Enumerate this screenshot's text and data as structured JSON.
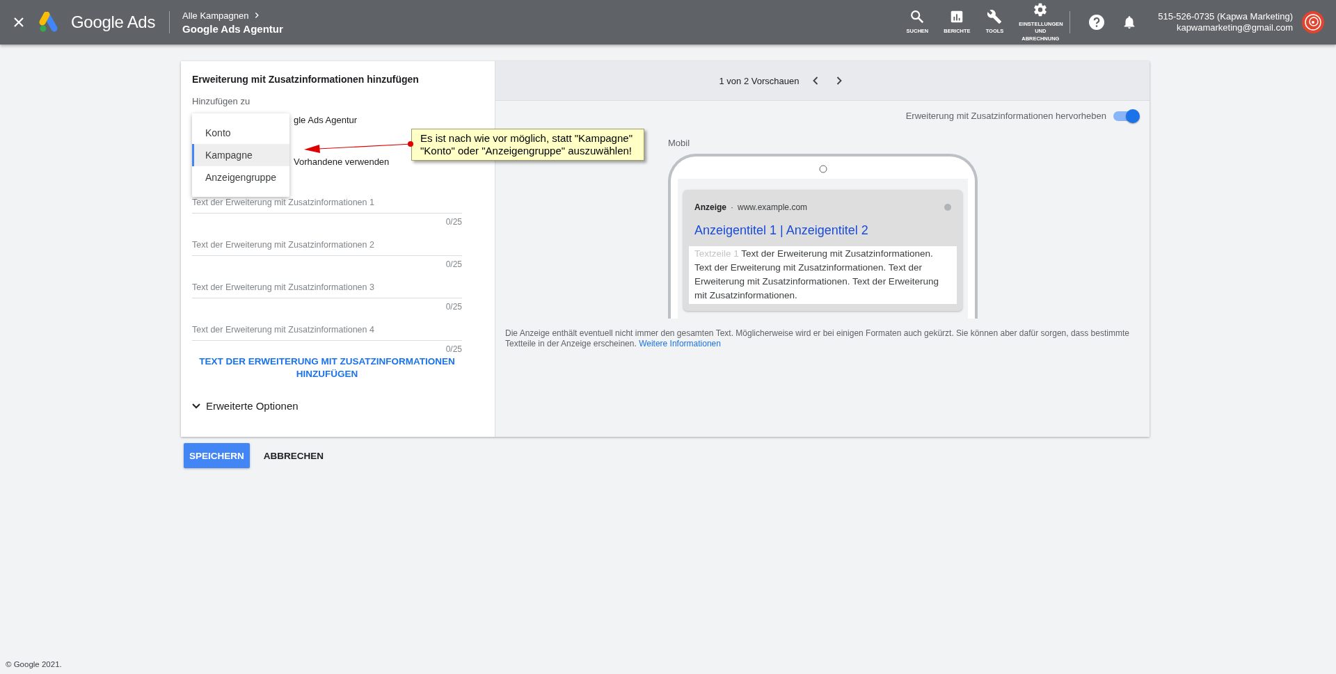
{
  "header": {
    "brand": "Google Ads",
    "breadcrumb": "Alle Kampagnen",
    "account": "Google Ads Agentur",
    "tools": [
      {
        "kind": "search",
        "label": "SUCHEN"
      },
      {
        "kind": "reports",
        "label": "BERICHTE"
      },
      {
        "kind": "tools",
        "label": "TOOLS"
      },
      {
        "kind": "settings",
        "label": "EINSTELLUNGEN UND ABRECHNUNG"
      }
    ],
    "phone": "515-526-0735 (Kapwa Marketing)",
    "email": "kapwamarketing@gmail.com"
  },
  "form": {
    "title": "Erweiterung mit Zusatzinformationen hinzufügen",
    "add_to_label": "Hinzufügen zu",
    "add_to_value": "gle Ads Agentur",
    "dropdown": [
      {
        "label": "Konto",
        "selected": false
      },
      {
        "label": "Kampagne",
        "selected": true
      },
      {
        "label": "Anzeigengruppe",
        "selected": false
      }
    ],
    "existing_option": "Vorhandene verwenden",
    "fields": [
      {
        "placeholder": "Text der Erweiterung mit Zusatzinformationen 1",
        "counter": "0/25"
      },
      {
        "placeholder": "Text der Erweiterung mit Zusatzinformationen 2",
        "counter": "0/25"
      },
      {
        "placeholder": "Text der Erweiterung mit Zusatzinformationen 3",
        "counter": "0/25"
      },
      {
        "placeholder": "Text der Erweiterung mit Zusatzinformationen 4",
        "counter": "0/25"
      }
    ],
    "add_link": "TEXT DER ERWEITERUNG MIT ZUSATZINFORMATIONEN HINZUFÜGEN",
    "advanced": {
      "label": "Erweiterte Optionen",
      "expanded": false
    }
  },
  "annotation": {
    "lines": [
      "Es ist nach wie vor möglich, statt \"Kampagne\"",
      "\"Konto\" oder \"Anzeigengruppe\" auszuwählen!"
    ]
  },
  "preview": {
    "pager": "1 von 2 Vorschauen",
    "highlight": {
      "label": "Erweiterung mit Zusatzinformationen hervorheben",
      "on": true
    },
    "device": "Mobil",
    "ad": {
      "badge": "Anzeige",
      "separator": "·",
      "url": "www.example.com",
      "headline": "Anzeigentitel 1 | Anzeigentitel 2",
      "line_label": "Textzeile 1",
      "description": "Text der Erweiterung mit Zusatzinformationen. Text der Erweiterung mit Zusatzinformationen. Text der Erweiterung mit Zusatzinformationen. Text der Erweiterung mit Zusatzinformationen."
    },
    "disclaimer": "Die Anzeige enthält eventuell nicht immer den gesamten Text. Möglicherweise wird er bei einigen Formaten auch gekürzt. Sie können aber dafür sorgen, dass bestimmte Textteile in der Anzeige erscheinen.",
    "more_link": "Weitere Informationen"
  },
  "buttons": [
    {
      "kind": "primary",
      "label": "SPEICHERN"
    },
    {
      "kind": "text",
      "label": "ABBRECHEN"
    }
  ],
  "footer": "© Google 2021."
}
